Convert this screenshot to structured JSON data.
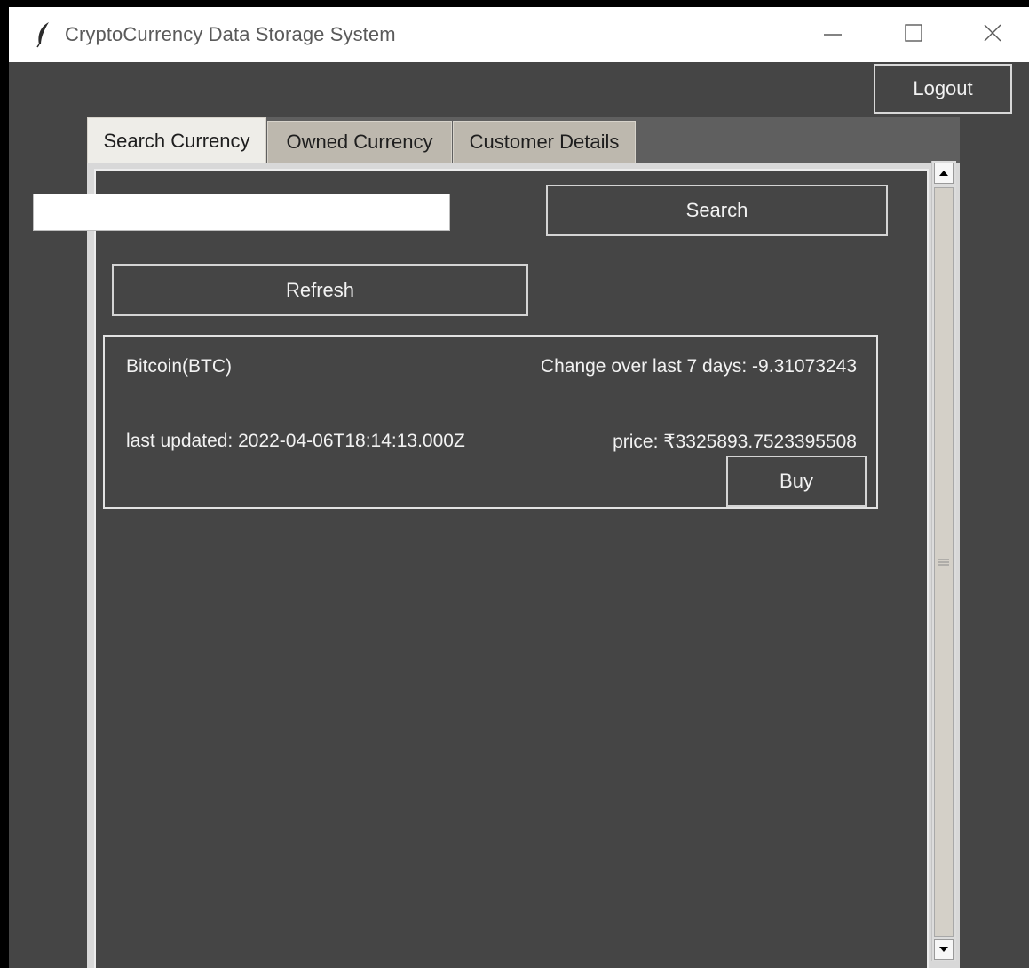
{
  "window": {
    "title": "CryptoCurrency Data Storage System",
    "app_icon": "feather-icon",
    "controls": [
      "minimize-icon",
      "maximize-icon",
      "close-icon"
    ]
  },
  "header": {
    "logout_label": "Logout"
  },
  "tabs": [
    {
      "label": "Search Currency",
      "active": true
    },
    {
      "label": "Owned Currency",
      "active": false
    },
    {
      "label": "Customer Details",
      "active": false
    }
  ],
  "search": {
    "value": "",
    "button_label": "Search",
    "refresh_label": "Refresh"
  },
  "results": [
    {
      "name": "Bitcoin(BTC)",
      "change": "Change over last 7 days: -9.31073243",
      "last_updated": "last updated: 2022-04-06T18:14:13.000Z",
      "price": "price: ₹3325893.7523395508",
      "buy_label": "Buy"
    }
  ],
  "colors": {
    "background": "#454545",
    "text": "#f2f2f2",
    "tab_active": "#eeede8",
    "tab_inactive": "#bdb8ae",
    "titlebar": "#ffffff"
  }
}
